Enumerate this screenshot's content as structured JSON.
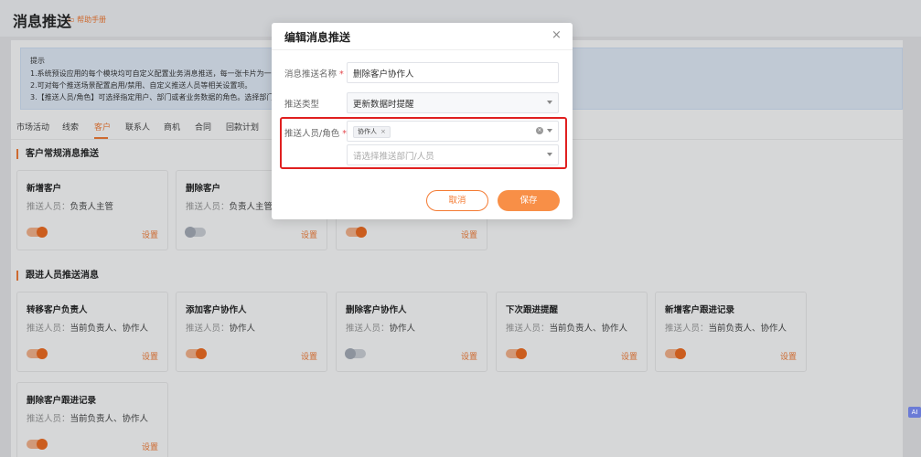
{
  "page": {
    "title": "消息推送",
    "help_link": "帮助手册"
  },
  "tip": {
    "title": "提示",
    "lines": [
      "1.系统预设应用的每个模块均可自定义配置业务消息推送，每一张卡片为一个触发",
      "2.可对每个推送场景配置启用/禁用、自定义推送人员等相关设置项。",
      "3.【推送人员/角色】可选择指定用户、部门或者业务数据的角色。选择部门时默认"
    ]
  },
  "tabs": [
    "市场活动",
    "线索",
    "客户",
    "联系人",
    "商机",
    "合同",
    "回款计划"
  ],
  "active_tab": "客户",
  "sections": [
    {
      "title": "客户常规消息推送",
      "cards": [
        {
          "title": "新增客户",
          "person_label": "推送人员：",
          "person": "负责人主管",
          "enabled": true,
          "setting": "设置"
        },
        {
          "title": "删除客户",
          "person_label": "推送人员：",
          "person": "负责人主管",
          "enabled": false,
          "setting": "设置"
        },
        {
          "title": "",
          "person_label": "",
          "person": "",
          "enabled": true,
          "setting": "设置"
        }
      ]
    },
    {
      "title": "跟进人员推送消息",
      "cards": [
        {
          "title": "转移客户负责人",
          "person_label": "推送人员：",
          "person": "当前负责人、协作人",
          "enabled": true,
          "setting": "设置"
        },
        {
          "title": "添加客户协作人",
          "person_label": "推送人员：",
          "person": "协作人",
          "enabled": true,
          "setting": "设置"
        },
        {
          "title": "删除客户协作人",
          "person_label": "推送人员：",
          "person": "协作人",
          "enabled": false,
          "setting": "设置"
        },
        {
          "title": "下次跟进提醒",
          "person_label": "推送人员：",
          "person": "当前负责人、协作人",
          "enabled": true,
          "setting": "设置"
        },
        {
          "title": "新增客户跟进记录",
          "person_label": "推送人员：",
          "person": "当前负责人、协作人",
          "enabled": true,
          "setting": "设置"
        },
        {
          "title": "删除客户跟进记录",
          "person_label": "推送人员：",
          "person": "当前负责人、协作人",
          "enabled": true,
          "setting": "设置"
        }
      ]
    }
  ],
  "modal": {
    "title": "编辑消息推送",
    "name_label": "消息推送名称",
    "name_value": "删除客户协作人",
    "type_label": "推送类型",
    "type_value": "更新数据时提醒",
    "people_label": "推送人员/角色",
    "people_tag": "协作人",
    "dept_placeholder": "请选择推送部门/人员",
    "cancel": "取消",
    "save": "保存"
  },
  "ai_badge": "AI"
}
